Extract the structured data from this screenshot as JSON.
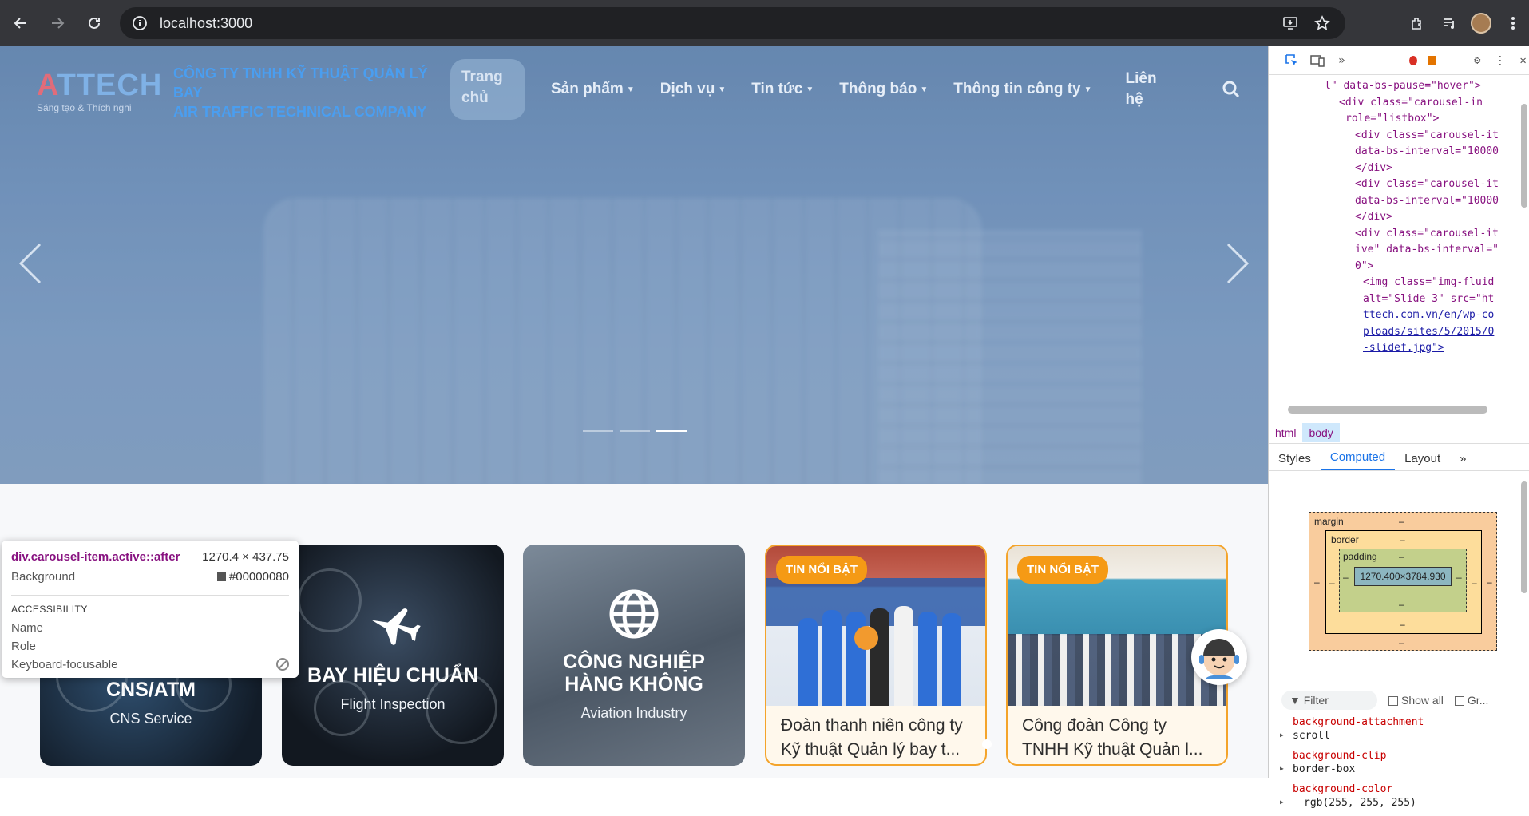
{
  "browser": {
    "url": "localhost:3000"
  },
  "site": {
    "logo_main": "ATTECH",
    "slogan": "Sáng tạo & Thích nghi",
    "company_line1": "CÔNG TY TNHH KỸ THUẬT QUẢN LÝ BAY",
    "company_line2": "AIR TRAFFIC TECHNICAL COMPANY",
    "nav": {
      "home": "Trang chủ",
      "products": "Sản phẩm",
      "services": "Dịch vụ",
      "news": "Tin tức",
      "announcements": "Thông báo",
      "company_info": "Thông tin công ty",
      "contact": "Liên hệ"
    },
    "carousel": {
      "slides": 3,
      "active_index": 3
    }
  },
  "cards": {
    "service1": {
      "title": "CNS/ATM",
      "subtitle": "CNS Service"
    },
    "service2": {
      "title": "BAY HIỆU CHUẨN",
      "subtitle": "Flight Inspection"
    },
    "service3": {
      "title": "CÔNG NGHIỆP HÀNG KHÔNG",
      "subtitle": "Aviation Industry"
    },
    "news1": {
      "badge": "TIN NỔI BẬT",
      "line1": "Đoàn thanh niên công ty",
      "line2": "Kỹ thuật Quản lý bay t..."
    },
    "news2": {
      "badge": "TIN NỔI BẬT",
      "line1": "Công đoàn Công ty",
      "line2": "TNHH Kỹ thuật Quản l..."
    }
  },
  "tooltip": {
    "selector": "div.carousel-item.active::after",
    "size": "1270.4 × 437.75",
    "background_label": "Background",
    "background_value": "#00000080",
    "accessibility_heading": "ACCESSIBILITY",
    "name_label": "Name",
    "role_label": "Role",
    "focusable_label": "Keyboard-focusable"
  },
  "devtools": {
    "dom_lines": [
      "l\" data-bs-pause=\"hover\">",
      "<div class=\"carousel-in",
      "role=\"listbox\">",
      "<div class=\"carousel-it",
      "data-bs-interval=\"10000",
      "</div>",
      "<div class=\"carousel-it",
      "data-bs-interval=\"10000",
      "</div>",
      "<div class=\"carousel-it",
      "ive\" data-bs-interval=\"",
      "0\">",
      "<img class=\"img-fluid",
      "alt=\"Slide 3\" src=\"ht",
      "ttech.com.vn/en/wp-co",
      "ploads/sites/5/2015/0",
      "-slidef.jpg\">"
    ],
    "breadcrumbs": [
      "html",
      "body"
    ],
    "tabs": [
      "Styles",
      "Computed",
      "Layout"
    ],
    "active_tab": "Computed",
    "box_model": {
      "margin_label": "margin",
      "border_label": "border",
      "padding_label": "padding",
      "content_size": "1270.400×3784.930",
      "dash": "–"
    },
    "filter_placeholder": "Filter",
    "show_all_label": "Show all",
    "group_label": "Gr...",
    "properties": [
      {
        "name": "background-attachment",
        "value": "scroll"
      },
      {
        "name": "background-clip",
        "value": "border-box"
      },
      {
        "name": "background-color",
        "value": "rgb(255, 255, 255)"
      }
    ]
  },
  "colors": {
    "accent_orange": "#f59a15",
    "company_blue": "#4a9ef0",
    "devtools_blue": "#1a73e8"
  }
}
